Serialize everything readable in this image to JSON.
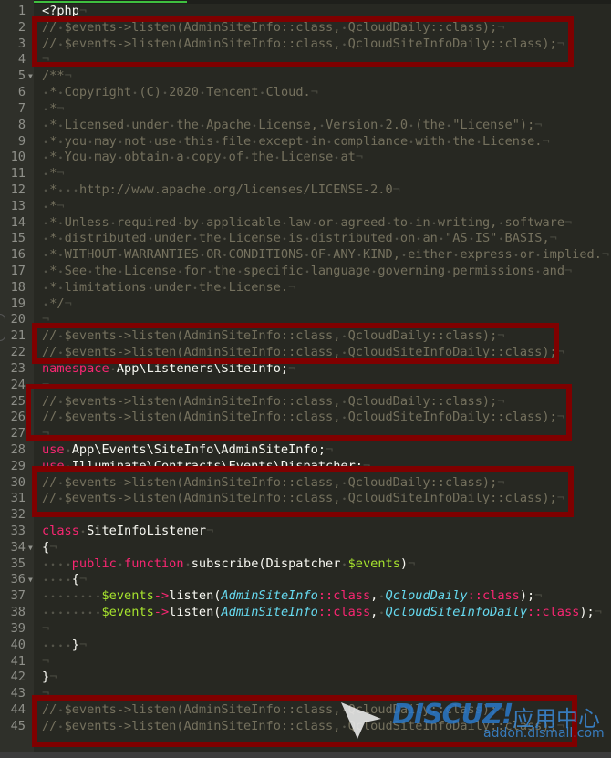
{
  "editor": {
    "theme_colors": {
      "background": "#272822",
      "comment": "#75715e",
      "keyword": "#f92672",
      "default": "#f8f8f2",
      "variable": "#a6e22e",
      "type": "#66d9ef",
      "highlight_box": "#7f0000"
    },
    "fold_lines": [
      5,
      34,
      36
    ],
    "highlight_ranges": [
      [
        2,
        4
      ],
      [
        21,
        22
      ],
      [
        24,
        27
      ],
      [
        30,
        31
      ],
      [
        44,
        45
      ]
    ],
    "lines": [
      [
        [
          "d",
          "<?php"
        ]
      ],
      [
        [
          "c",
          "// $events->listen(AdminSiteInfo::class, QcloudDaily::class);"
        ]
      ],
      [
        [
          "c",
          "// $events->listen(AdminSiteInfo::class, QcloudSiteInfoDaily::class);"
        ]
      ],
      [],
      [
        [
          "c",
          "/**"
        ]
      ],
      [
        [
          "c",
          " * Copyright (C) 2020 Tencent Cloud."
        ]
      ],
      [
        [
          "c",
          " *"
        ]
      ],
      [
        [
          "c",
          " * Licensed under the Apache License, Version 2.0 (the \"License\");"
        ]
      ],
      [
        [
          "c",
          " * you may not use this file except in compliance with the License."
        ]
      ],
      [
        [
          "c",
          " * You may obtain a copy of the License at"
        ]
      ],
      [
        [
          "c",
          " *"
        ]
      ],
      [
        [
          "c",
          " *   http://www.apache.org/licenses/LICENSE-2.0"
        ]
      ],
      [
        [
          "c",
          " *"
        ]
      ],
      [
        [
          "c",
          " * Unless required by applicable law or agreed to in writing, software"
        ]
      ],
      [
        [
          "c",
          " * distributed under the License is distributed on an \"AS IS\" BASIS,"
        ]
      ],
      [
        [
          "c",
          " * WITHOUT WARRANTIES OR CONDITIONS OF ANY KIND, either express or implied."
        ]
      ],
      [
        [
          "c",
          " * See the License for the specific language governing permissions and"
        ]
      ],
      [
        [
          "c",
          " * limitations under the License."
        ]
      ],
      [
        [
          "c",
          " */"
        ]
      ],
      [],
      [
        [
          "c",
          "// $events->listen(AdminSiteInfo::class, QcloudDaily::class);"
        ]
      ],
      [
        [
          "c",
          "// $events->listen(AdminSiteInfo::class, QcloudSiteInfoDaily::class);"
        ]
      ],
      [
        [
          "k",
          "namespace"
        ],
        [
          "d",
          " App\\Listeners\\SiteInfo;"
        ]
      ],
      [],
      [
        [
          "c",
          "// $events->listen(AdminSiteInfo::class, QcloudDaily::class);"
        ]
      ],
      [
        [
          "c",
          "// $events->listen(AdminSiteInfo::class, QcloudSiteInfoDaily::class);"
        ]
      ],
      [],
      [
        [
          "k",
          "use"
        ],
        [
          "d",
          " App\\Events\\SiteInfo\\AdminSiteInfo;"
        ]
      ],
      [
        [
          "k",
          "use"
        ],
        [
          "d",
          " Illuminate\\Contracts\\Events\\Dispatcher;"
        ]
      ],
      [
        [
          "c",
          "// $events->listen(AdminSiteInfo::class, QcloudDaily::class);"
        ]
      ],
      [
        [
          "c",
          "// $events->listen(AdminSiteInfo::class, QcloudSiteInfoDaily::class);"
        ]
      ],
      [],
      [
        [
          "k",
          "class"
        ],
        [
          "d",
          " SiteInfoListener"
        ]
      ],
      [
        [
          "d",
          "{"
        ]
      ],
      [
        [
          "d",
          "    "
        ],
        [
          "k",
          "public"
        ],
        [
          "d",
          " "
        ],
        [
          "k",
          "function"
        ],
        [
          "d",
          " subscribe(Dispatcher "
        ],
        [
          "v",
          "$events"
        ],
        [
          "d",
          ")"
        ]
      ],
      [
        [
          "d",
          "    {"
        ]
      ],
      [
        [
          "d",
          "        "
        ],
        [
          "v",
          "$events"
        ],
        [
          "k",
          "->"
        ],
        [
          "d",
          "listen("
        ],
        [
          "t",
          "AdminSiteInfo"
        ],
        [
          "k",
          "::class"
        ],
        [
          "d",
          ", "
        ],
        [
          "t",
          "QcloudDaily"
        ],
        [
          "k",
          "::class"
        ],
        [
          "d",
          ");"
        ]
      ],
      [
        [
          "d",
          "        "
        ],
        [
          "v",
          "$events"
        ],
        [
          "k",
          "->"
        ],
        [
          "d",
          "listen("
        ],
        [
          "t",
          "AdminSiteInfo"
        ],
        [
          "k",
          "::class"
        ],
        [
          "d",
          ", "
        ],
        [
          "t",
          "QcloudSiteInfoDaily"
        ],
        [
          "k",
          "::class"
        ],
        [
          "d",
          ");"
        ]
      ],
      [],
      [
        [
          "d",
          "    }"
        ]
      ],
      [],
      [
        [
          "d",
          "}"
        ]
      ],
      [],
      [
        [
          "c",
          "// $events->listen(AdminSiteInfo::class, QcloudDaily::class);"
        ]
      ],
      [
        [
          "c",
          "// $events->listen(AdminSiteInfo::class, QcloudSiteInfoDaily::class);"
        ]
      ]
    ]
  },
  "watermark": {
    "logo": "DISCUZ!",
    "cn": "应用中心",
    "url": "addon.dismall.com"
  }
}
